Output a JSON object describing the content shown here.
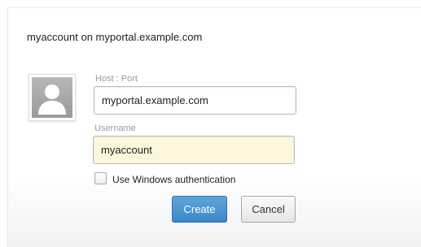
{
  "dialog": {
    "title": "myaccount on myportal.example.com"
  },
  "avatar": {
    "icon": "user-placeholder-icon"
  },
  "form": {
    "host_label": "Host : Port",
    "host_value": "myportal.example.com",
    "username_label": "Username",
    "username_value": "myaccount",
    "windows_auth_label": "Use Windows authentication",
    "windows_auth_checked": false
  },
  "buttons": {
    "create_label": "Create",
    "cancel_label": "Cancel"
  },
  "colors": {
    "primary_button": "#3a86c8",
    "focused_input_bg": "#fdf6dd"
  }
}
